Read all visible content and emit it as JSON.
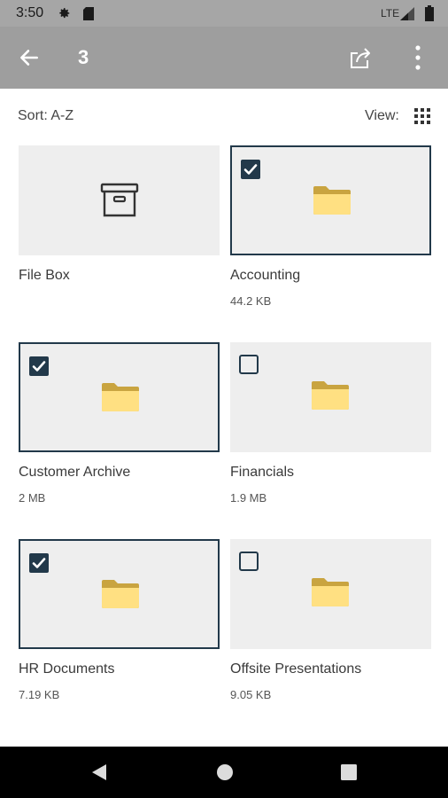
{
  "status_bar": {
    "time": "3:50",
    "network": "LTE",
    "icons": [
      "settings-icon",
      "sd-card-icon",
      "signal-icon",
      "battery-icon"
    ]
  },
  "app_bar": {
    "selected_count": "3",
    "icons": [
      "back-arrow-icon",
      "share-icon",
      "more-vert-icon"
    ]
  },
  "toolbar": {
    "sort_label": "Sort: A-Z",
    "view_label": "View:",
    "view_icon": "grid-view-icon"
  },
  "items": [
    {
      "name": "File Box",
      "size": "",
      "type": "file-box",
      "selectable": false,
      "checked": false
    },
    {
      "name": "Accounting",
      "size": "44.2 KB",
      "type": "folder",
      "selectable": true,
      "checked": true
    },
    {
      "name": "Customer Archive",
      "size": "2 MB",
      "type": "folder",
      "selectable": true,
      "checked": true
    },
    {
      "name": "Financials",
      "size": "1.9 MB",
      "type": "folder",
      "selectable": true,
      "checked": false
    },
    {
      "name": "HR Documents",
      "size": "7.19 KB",
      "type": "folder",
      "selectable": true,
      "checked": true
    },
    {
      "name": "Offsite Presentations",
      "size": "9.05 KB",
      "type": "folder",
      "selectable": true,
      "checked": false
    }
  ],
  "colors": {
    "status_bar": "#a6a6a6",
    "app_bar": "#9e9e9e",
    "tile_background": "#eeeeee",
    "selection_border": "#22394a",
    "folder_yellow": "#ffe082",
    "folder_tab": "#c9a440",
    "nav_bar": "#000000"
  },
  "nav_bar": {
    "icons": [
      "back-triangle-icon",
      "home-circle-icon",
      "recents-square-icon"
    ]
  }
}
